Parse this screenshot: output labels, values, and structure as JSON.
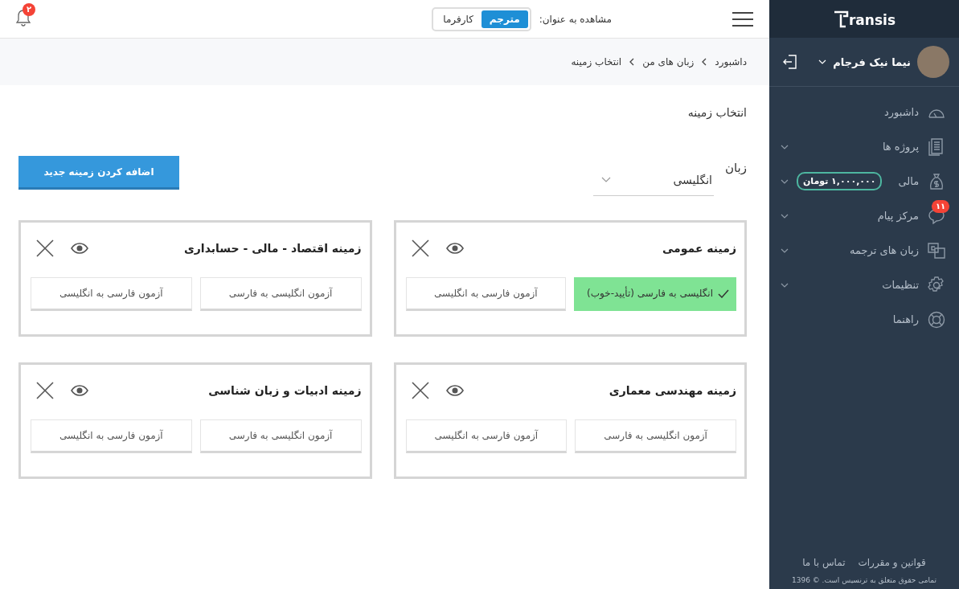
{
  "sidebar": {
    "logo": "ransis",
    "user": {
      "name": "نیما نیک فرجام"
    },
    "items": [
      {
        "kind": "gauge",
        "label": "داشبورد",
        "expandable": false
      },
      {
        "kind": "document",
        "label": "پروژه ها",
        "expandable": true
      },
      {
        "kind": "moneybag",
        "label": "مالی",
        "expandable": true,
        "amount": "۱,۰۰۰,۰۰۰ تومان"
      },
      {
        "kind": "chat",
        "label": "مرکز پیام",
        "expandable": true,
        "badge": "۱۱"
      },
      {
        "kind": "translate",
        "label": "زبان های ترجمه",
        "expandable": true
      },
      {
        "kind": "gear",
        "label": "تنظیمات",
        "expandable": true
      },
      {
        "kind": "lifebuoy",
        "label": "راهنما",
        "expandable": false
      }
    ],
    "footer_links": [
      "قوانین و مقررات",
      "تماس با ما"
    ],
    "copyright": "تمامی حقوق متعلق به ترنسیس است. © 1396"
  },
  "topbar": {
    "view_as_label": "مشاهده به عنوان:",
    "roles": [
      {
        "label": "مترجم",
        "selected": true
      },
      {
        "label": "کارفرما",
        "selected": false
      }
    ],
    "notification_count": "۲"
  },
  "breadcrumb": [
    "داشبورد",
    "زبان های من",
    "انتخاب زمینه"
  ],
  "page_title": "انتخاب زمینه",
  "language": {
    "label": "زبان",
    "value": "انگلیسی"
  },
  "add_button": "اضافه کردن زمینه جدید",
  "fields": [
    {
      "title": "زمینه عمومی",
      "tests": [
        {
          "kind": "passed",
          "label": "انگلیسی به فارسی (تأیید-خوب)"
        },
        {
          "kind": "test",
          "label": "آزمون فارسی به انگلیسی"
        }
      ]
    },
    {
      "title": "زمینه اقتصاد - مالی - حسابداری",
      "tests": [
        {
          "kind": "test",
          "label": "آزمون انگلیسی به فارسی"
        },
        {
          "kind": "test",
          "label": "آزمون فارسی به انگلیسی"
        }
      ]
    },
    {
      "title": "زمینه مهندسی معماری",
      "tests": [
        {
          "kind": "test",
          "label": "آزمون انگلیسی به فارسی"
        },
        {
          "kind": "test",
          "label": "آزمون فارسی به انگلیسی"
        }
      ]
    },
    {
      "title": "زمینه ادبیات و زبان شناسی",
      "tests": [
        {
          "kind": "test",
          "label": "آزمون انگلیسی به فارسی"
        },
        {
          "kind": "test",
          "label": "آزمون فارسی به انگلیسی"
        }
      ]
    }
  ]
}
